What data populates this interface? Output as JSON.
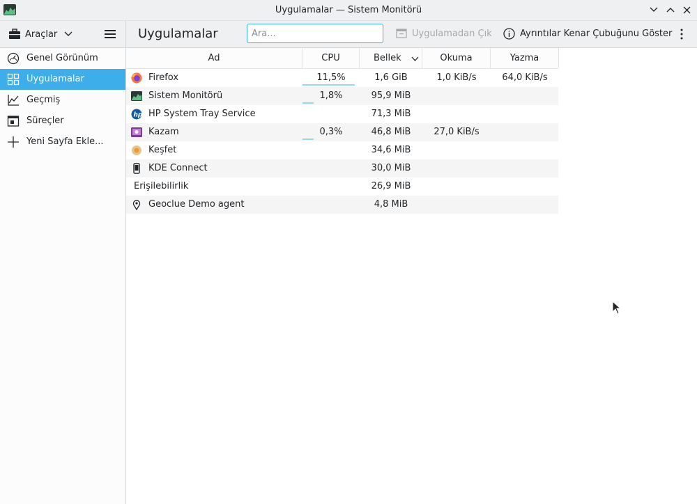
{
  "window": {
    "title": "Uygulamalar — Sistem Monitörü",
    "buttons": [
      "minimize",
      "maximize",
      "close"
    ]
  },
  "toolbar": {
    "tools_label": "Araçlar",
    "page_title": "Uygulamalar",
    "search_placeholder": "Ara...",
    "quit_label": "Uygulamadan Çık",
    "details_label": "Ayrıntılar Kenar Çubuğunu Göster"
  },
  "sidebar": {
    "items": [
      {
        "label": "Genel Görünüm",
        "icon": "gauge-icon",
        "active": false
      },
      {
        "label": "Uygulamalar",
        "icon": "grid-icon",
        "active": true
      },
      {
        "label": "Geçmiş",
        "icon": "chart-icon",
        "active": false
      },
      {
        "label": "Süreçler",
        "icon": "window-icon",
        "active": false
      },
      {
        "label": "Yeni Sayfa Ekle...",
        "icon": "plus-icon",
        "active": false
      }
    ]
  },
  "table": {
    "columns": [
      "Ad",
      "CPU",
      "Bellek",
      "Okuma",
      "Yazma"
    ],
    "sort_column": "Bellek",
    "rows": [
      {
        "name": "Firefox",
        "icon": "firefox-icon",
        "cpu": "11,5%",
        "cpu_fraction": 0.115,
        "memory": "1,6 GiB",
        "read": "1,0 KiB/s",
        "write": "64,0 KiB/s"
      },
      {
        "name": "Sistem Monitörü",
        "icon": "system-monitor-icon",
        "cpu": "1,8%",
        "cpu_fraction": 0.018,
        "memory": "95,9 MiB",
        "read": "",
        "write": ""
      },
      {
        "name": "HP System Tray Service",
        "icon": "hp-icon",
        "cpu": "",
        "cpu_fraction": 0,
        "memory": "71,3 MiB",
        "read": "",
        "write": ""
      },
      {
        "name": "Kazam",
        "icon": "kazam-icon",
        "cpu": "0,3%",
        "cpu_fraction": 0.003,
        "memory": "46,8 MiB",
        "read": "27,0 KiB/s",
        "write": ""
      },
      {
        "name": "Keşfet",
        "icon": "discover-icon",
        "cpu": "",
        "cpu_fraction": 0,
        "memory": "34,6 MiB",
        "read": "",
        "write": ""
      },
      {
        "name": "KDE Connect",
        "icon": "kde-connect-icon",
        "cpu": "",
        "cpu_fraction": 0,
        "memory": "30,0 MiB",
        "read": "",
        "write": ""
      },
      {
        "name": "Erişilebilirlik",
        "icon": "",
        "cpu": "",
        "cpu_fraction": 0,
        "memory": "26,9 MiB",
        "read": "",
        "write": ""
      },
      {
        "name": "Geoclue Demo agent",
        "icon": "location-icon",
        "cpu": "",
        "cpu_fraction": 0,
        "memory": "4,8 MiB",
        "read": "",
        "write": ""
      }
    ]
  }
}
